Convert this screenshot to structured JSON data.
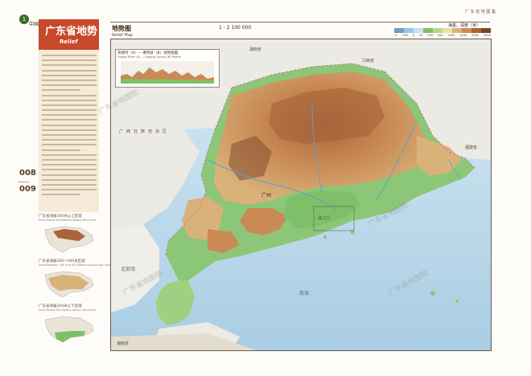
{
  "chapter": {
    "number": "1",
    "section": "中国"
  },
  "pages": {
    "left": "008",
    "right": "009"
  },
  "sidebar": {
    "title_cn": "广东省地势",
    "title_en": "Relief",
    "thumbnails": [
      {
        "caption": "广东省海拔500米以上区域",
        "caption_en": "Area Above 500 Meters Above Sea Level"
      },
      {
        "caption": "广东省海拔200～500米区域",
        "caption_en": "Area Between 200 and 500 Meters Above Sea Level"
      },
      {
        "caption": "广东省海拔200米以下区域",
        "caption_en": "Area Below 200 Meters Above Sea Level"
      }
    ]
  },
  "map": {
    "title": "地势图",
    "subtitle": "Relief Map",
    "scale": "1 : 2 100 000",
    "header_right": "广 东 省 地 图 集",
    "legend": {
      "title": "海拔、深度（米）",
      "ticks": [
        "-5",
        "-200",
        "0",
        "50",
        "200",
        "500",
        "1000",
        "1500",
        "2000",
        "2500"
      ],
      "colors": [
        "#6d9ec8",
        "#9cc3e0",
        "#c9e1f0",
        "#7fbf6a",
        "#b8d88a",
        "#e9e0a6",
        "#d9b27a",
        "#c98a55",
        "#a8643a",
        "#7a4426"
      ]
    },
    "inset": {
      "title": "英德河（A）— 佛冈县（B）地势剖面",
      "subtitle": "Yingde River (A) — Fogang County (B) Profile"
    },
    "labels": {
      "hunan": "湖南省",
      "jiangxi": "江西省",
      "guangxi": "广西壮族自治区",
      "fujian": "福建省",
      "nanhai": "南海",
      "beibu": "北部湾",
      "hainan": "海南省",
      "guangzhou": "广州",
      "zhuhai": "珠江口"
    },
    "watermark": "广东省地图院"
  },
  "colors": {
    "accent": "#c8482b",
    "sea": "#c9e1f0",
    "land_low": "#7fbf6a"
  }
}
